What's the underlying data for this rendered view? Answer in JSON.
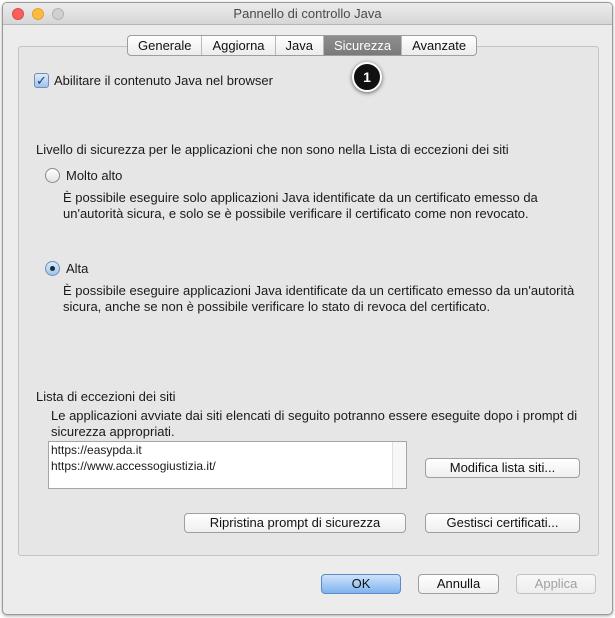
{
  "window": {
    "title": "Pannello di controllo Java"
  },
  "tabs": [
    {
      "label": "Generale",
      "active": false
    },
    {
      "label": "Aggiorna",
      "active": false
    },
    {
      "label": "Java",
      "active": false
    },
    {
      "label": "Sicurezza",
      "active": true
    },
    {
      "label": "Avanzate",
      "active": false
    }
  ],
  "security": {
    "enable_java_label": "Abilitare il contenuto Java nel browser",
    "enable_java_checked": true,
    "step_badge": "1",
    "level_heading": "Livello di sicurezza per le applicazioni che non sono nella Lista di eccezioni dei siti",
    "levels": [
      {
        "label": "Molto alto",
        "selected": false,
        "description": "È possibile eseguire solo applicazioni Java identificate da un certificato emesso da un'autorità sicura, e solo se è possibile verificare il certificato come non revocato."
      },
      {
        "label": "Alta",
        "selected": true,
        "description": "È possibile eseguire applicazioni Java identificate da un certificato emesso da un'autorità sicura, anche se non è possibile verificare lo stato di revoca del certificato."
      }
    ]
  },
  "exceptions": {
    "heading": "Lista di eccezioni dei siti",
    "description": "Le applicazioni avviate dai siti elencati di seguito potranno essere eseguite dopo i prompt di sicurezza appropriati.",
    "sites": [
      "https://easypda.it",
      "https://www.accessogiustizia.it/"
    ],
    "edit_button": "Modifica lista siti..."
  },
  "buttons": {
    "restore_prompts": "Ripristina prompt di sicurezza",
    "manage_certs": "Gestisci certificati...",
    "ok": "OK",
    "cancel": "Annulla",
    "apply": "Applica"
  },
  "colors": {
    "window_bg": "#ececec",
    "active_tab": "#7f7f7f",
    "default_button": "#7fb3ef",
    "close_button": "#fc605c",
    "minimize_button": "#fdbc40"
  },
  "icons": {
    "close": "close-icon",
    "minimize": "minimize-icon",
    "zoom": "zoom-icon",
    "checkmark": "checkmark-icon"
  }
}
